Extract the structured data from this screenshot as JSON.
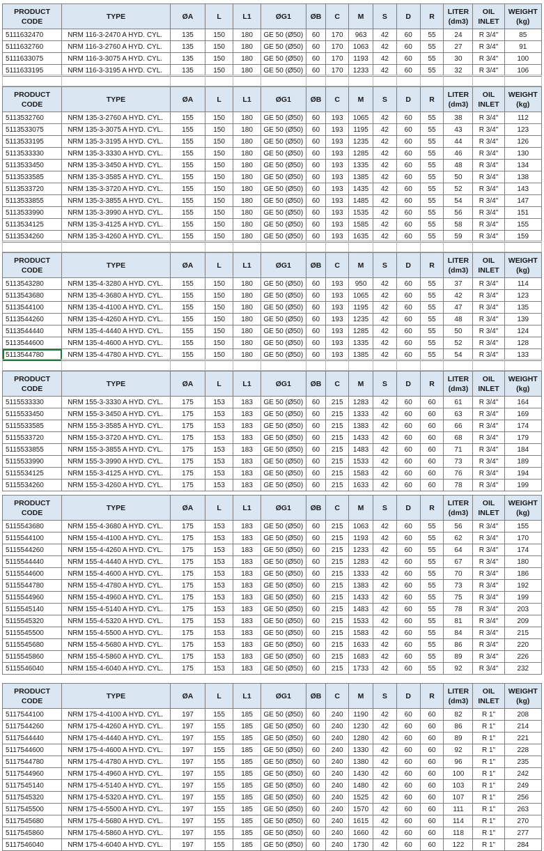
{
  "headers": {
    "code": "PRODUCT CODE",
    "type": "TYPE",
    "a": "ØA",
    "l": "L",
    "l1": "L1",
    "g1": "ØG1",
    "b": "ØB",
    "c": "C",
    "m": "M",
    "s": "S",
    "d": "D",
    "r": "R",
    "liter": "LITER (dm3)",
    "oil": "OIL INLET",
    "weight": "WEIGHT (kg)"
  },
  "blocks": [
    {
      "rows": [
        [
          "5111632470",
          "NRM 116-3-2470 A HYD. CYL.",
          "135",
          "150",
          "180",
          "GE 50 (Ø50)",
          "60",
          "170",
          "963",
          "42",
          "60",
          "55",
          "24",
          "R 3/4\"",
          "85"
        ],
        [
          "5111632760",
          "NRM 116-3-2760 A HYD. CYL.",
          "135",
          "150",
          "180",
          "GE 50 (Ø50)",
          "60",
          "170",
          "1063",
          "42",
          "60",
          "55",
          "27",
          "R 3/4\"",
          "91"
        ],
        [
          "5111633075",
          "NRM 116-3-3075 A HYD. CYL.",
          "135",
          "150",
          "180",
          "GE 50 (Ø50)",
          "60",
          "170",
          "1193",
          "42",
          "60",
          "55",
          "30",
          "R 3/4\"",
          "100"
        ],
        [
          "5111633195",
          "NRM 116-3-3195 A HYD. CYL.",
          "135",
          "150",
          "180",
          "GE 50 (Ø50)",
          "60",
          "170",
          "1233",
          "42",
          "60",
          "55",
          "32",
          "R 3/4\"",
          "106"
        ]
      ]
    },
    {
      "rows": [
        [
          "5113532760",
          "NRM 135-3-2760 A HYD. CYL.",
          "155",
          "150",
          "180",
          "GE 50 (Ø50)",
          "60",
          "193",
          "1065",
          "42",
          "60",
          "55",
          "38",
          "R 3/4\"",
          "112"
        ],
        [
          "5113533075",
          "NRM 135-3-3075 A HYD. CYL.",
          "155",
          "150",
          "180",
          "GE 50 (Ø50)",
          "60",
          "193",
          "1195",
          "42",
          "60",
          "55",
          "43",
          "R 3/4\"",
          "123"
        ],
        [
          "5113533195",
          "NRM 135-3-3195 A HYD. CYL.",
          "155",
          "150",
          "180",
          "GE 50 (Ø50)",
          "60",
          "193",
          "1235",
          "42",
          "60",
          "55",
          "44",
          "R 3/4\"",
          "126"
        ],
        [
          "5113533330",
          "NRM 135-3-3330 A HYD. CYL.",
          "155",
          "150",
          "180",
          "GE 50 (Ø50)",
          "60",
          "193",
          "1285",
          "42",
          "60",
          "55",
          "46",
          "R 3/4\"",
          "130"
        ],
        [
          "5113533450",
          "NRM 135-3-3450 A HYD. CYL.",
          "155",
          "150",
          "180",
          "GE 50 (Ø50)",
          "60",
          "193",
          "1335",
          "42",
          "60",
          "55",
          "48",
          "R 3/4\"",
          "134"
        ],
        [
          "5113533585",
          "NRM 135-3-3585 A HYD. CYL.",
          "155",
          "150",
          "180",
          "GE 50 (Ø50)",
          "60",
          "193",
          "1385",
          "42",
          "60",
          "55",
          "50",
          "R 3/4\"",
          "138"
        ],
        [
          "5113533720",
          "NRM 135-3-3720 A HYD. CYL.",
          "155",
          "150",
          "180",
          "GE 50 (Ø50)",
          "60",
          "193",
          "1435",
          "42",
          "60",
          "55",
          "52",
          "R 3/4\"",
          "143"
        ],
        [
          "5113533855",
          "NRM 135-3-3855 A HYD. CYL.",
          "155",
          "150",
          "180",
          "GE 50 (Ø50)",
          "60",
          "193",
          "1485",
          "42",
          "60",
          "55",
          "54",
          "R 3/4\"",
          "147"
        ],
        [
          "5113533990",
          "NRM 135-3-3990 A HYD. CYL.",
          "155",
          "150",
          "180",
          "GE 50 (Ø50)",
          "60",
          "193",
          "1535",
          "42",
          "60",
          "55",
          "56",
          "R 3/4\"",
          "151"
        ],
        [
          "5113534125",
          "NRM 135-3-4125 A HYD. CYL.",
          "155",
          "150",
          "180",
          "GE 50 (Ø50)",
          "60",
          "193",
          "1585",
          "42",
          "60",
          "55",
          "58",
          "R 3/4\"",
          "155"
        ],
        [
          "5113534260",
          "NRM 135-3-4260 A HYD. CYL.",
          "155",
          "150",
          "180",
          "GE 50 (Ø50)",
          "60",
          "193",
          "1635",
          "42",
          "60",
          "55",
          "59",
          "R 3/4\"",
          "159"
        ]
      ]
    },
    {
      "rows": [
        [
          "5113543280",
          "NRM 135-4-3280 A HYD. CYL.",
          "155",
          "150",
          "180",
          "GE 50 (Ø50)",
          "60",
          "193",
          "950",
          "42",
          "60",
          "55",
          "37",
          "R 3/4\"",
          "114"
        ],
        [
          "5113543680",
          "NRM 135-4-3680 A HYD. CYL.",
          "155",
          "150",
          "180",
          "GE 50 (Ø50)",
          "60",
          "193",
          "1065",
          "42",
          "60",
          "55",
          "42",
          "R 3/4\"",
          "123"
        ],
        [
          "5113544100",
          "NRM 135-4-4100 A HYD. CYL.",
          "155",
          "150",
          "180",
          "GE 50 (Ø50)",
          "60",
          "193",
          "1195",
          "42",
          "60",
          "55",
          "47",
          "R 3/4\"",
          "135"
        ],
        [
          "5113544260",
          "NRM 135-4-4260 A HYD. CYL.",
          "155",
          "150",
          "180",
          "GE 50 (Ø50)",
          "60",
          "193",
          "1235",
          "42",
          "60",
          "55",
          "48",
          "R 3/4\"",
          "139"
        ],
        [
          "5113544440",
          "NRM 135-4-4440 A HYD. CYL.",
          "155",
          "150",
          "180",
          "GE 50 (Ø50)",
          "60",
          "193",
          "1285",
          "42",
          "60",
          "55",
          "50",
          "R 3/4\"",
          "124"
        ],
        [
          "5113544600",
          "NRM 135-4-4600 A HYD. CYL.",
          "155",
          "150",
          "180",
          "GE 50 (Ø50)",
          "60",
          "193",
          "1335",
          "42",
          "60",
          "55",
          "52",
          "R 3/4\"",
          "128"
        ],
        [
          "5113544780",
          "NRM 135-4-4780 A HYD. CYL.",
          "155",
          "150",
          "180",
          "GE 50 (Ø50)",
          "60",
          "193",
          "1385",
          "42",
          "60",
          "55",
          "54",
          "R 3/4\"",
          "133"
        ]
      ]
    },
    {
      "rows": [
        [
          "5115533330",
          "NRM 155-3-3330 A HYD. CYL.",
          "175",
          "153",
          "183",
          "GE 50 (Ø50)",
          "60",
          "215",
          "1283",
          "42",
          "60",
          "60",
          "61",
          "R 3/4\"",
          "164"
        ],
        [
          "5115533450",
          "NRM 155-3-3450 A HYD. CYL.",
          "175",
          "153",
          "183",
          "GE 50 (Ø50)",
          "60",
          "215",
          "1333",
          "42",
          "60",
          "60",
          "63",
          "R 3/4\"",
          "169"
        ],
        [
          "5115533585",
          "NRM 155-3-3585 A HYD. CYL.",
          "175",
          "153",
          "183",
          "GE 50 (Ø50)",
          "60",
          "215",
          "1383",
          "42",
          "60",
          "60",
          "66",
          "R 3/4\"",
          "174"
        ],
        [
          "5115533720",
          "NRM 155-3-3720 A HYD. CYL.",
          "175",
          "153",
          "183",
          "GE 50 (Ø50)",
          "60",
          "215",
          "1433",
          "42",
          "60",
          "60",
          "68",
          "R 3/4\"",
          "179"
        ],
        [
          "5115533855",
          "NRM 155-3-3855 A HYD. CYL.",
          "175",
          "153",
          "183",
          "GE 50 (Ø50)",
          "60",
          "215",
          "1483",
          "42",
          "60",
          "60",
          "71",
          "R 3/4\"",
          "184"
        ],
        [
          "5115533990",
          "NRM 155-3-3990 A HYD. CYL.",
          "175",
          "153",
          "183",
          "GE 50 (Ø50)",
          "60",
          "215",
          "1533",
          "42",
          "60",
          "60",
          "73",
          "R 3/4\"",
          "189"
        ],
        [
          "5115534125",
          "NRM 155-3-4125 A HYD. CYL.",
          "175",
          "153",
          "183",
          "GE 50 (Ø50)",
          "60",
          "215",
          "1583",
          "42",
          "60",
          "60",
          "76",
          "R 3/4\"",
          "194"
        ],
        [
          "5115534260",
          "NRM 155-3-4260 A HYD. CYL.",
          "175",
          "153",
          "183",
          "GE 50 (Ø50)",
          "60",
          "215",
          "1633",
          "42",
          "60",
          "60",
          "78",
          "R 3/4\"",
          "199"
        ]
      ]
    },
    {
      "rows": [
        [
          "5115543680",
          "NRM 155-4-3680 A HYD. CYL.",
          "175",
          "153",
          "183",
          "GE 50 (Ø50)",
          "60",
          "215",
          "1063",
          "42",
          "60",
          "55",
          "56",
          "R 3/4\"",
          "155"
        ],
        [
          "5115544100",
          "NRM 155-4-4100 A HYD. CYL.",
          "175",
          "153",
          "183",
          "GE 50 (Ø50)",
          "60",
          "215",
          "1193",
          "42",
          "60",
          "55",
          "62",
          "R 3/4\"",
          "170"
        ],
        [
          "5115544260",
          "NRM 155-4-4260 A HYD. CYL.",
          "175",
          "153",
          "183",
          "GE 50 (Ø50)",
          "60",
          "215",
          "1233",
          "42",
          "60",
          "55",
          "64",
          "R 3/4\"",
          "174"
        ],
        [
          "5115544440",
          "NRM 155-4-4440 A HYD. CYL.",
          "175",
          "153",
          "183",
          "GE 50 (Ø50)",
          "60",
          "215",
          "1283",
          "42",
          "60",
          "55",
          "67",
          "R 3/4\"",
          "180"
        ],
        [
          "5115544600",
          "NRM 155-4-4600 A HYD. CYL.",
          "175",
          "153",
          "183",
          "GE 50 (Ø50)",
          "60",
          "215",
          "1333",
          "42",
          "60",
          "55",
          "70",
          "R 3/4\"",
          "186"
        ],
        [
          "5115544780",
          "NRM 155-4-4780 A HYD. CYL.",
          "175",
          "153",
          "183",
          "GE 50 (Ø50)",
          "60",
          "215",
          "1383",
          "42",
          "60",
          "55",
          "73",
          "R 3/4\"",
          "192"
        ],
        [
          "5115544960",
          "NRM 155-4-4960 A HYD. CYL.",
          "175",
          "153",
          "183",
          "GE 50 (Ø50)",
          "60",
          "215",
          "1433",
          "42",
          "60",
          "55",
          "75",
          "R 3/4\"",
          "199"
        ],
        [
          "5115545140",
          "NRM 155-4-5140 A HYD. CYL.",
          "175",
          "153",
          "183",
          "GE 50 (Ø50)",
          "60",
          "215",
          "1483",
          "42",
          "60",
          "55",
          "78",
          "R 3/4\"",
          "203"
        ],
        [
          "5115545320",
          "NRM 155-4-5320 A HYD. CYL.",
          "175",
          "153",
          "183",
          "GE 50 (Ø50)",
          "60",
          "215",
          "1533",
          "42",
          "60",
          "55",
          "81",
          "R 3/4\"",
          "209"
        ],
        [
          "5115545500",
          "NRM 155-4-5500 A HYD. CYL.",
          "175",
          "153",
          "183",
          "GE 50 (Ø50)",
          "60",
          "215",
          "1583",
          "42",
          "60",
          "55",
          "84",
          "R 3/4\"",
          "215"
        ],
        [
          "5115545680",
          "NRM 155-4-5680 A HYD. CYL.",
          "175",
          "153",
          "183",
          "GE 50 (Ø50)",
          "60",
          "215",
          "1633",
          "42",
          "60",
          "55",
          "86",
          "R 3/4\"",
          "220"
        ],
        [
          "5115545860",
          "NRM 155-4-5860 A HYD. CYL.",
          "175",
          "153",
          "183",
          "GE 50 (Ø50)",
          "60",
          "215",
          "1683",
          "42",
          "60",
          "55",
          "89",
          "R 3/4\"",
          "226"
        ],
        [
          "5115546040",
          "NRM 155-4-6040 A HYD. CYL.",
          "175",
          "153",
          "183",
          "GE 50 (Ø50)",
          "60",
          "215",
          "1733",
          "42",
          "60",
          "55",
          "92",
          "R 3/4\"",
          "232"
        ]
      ]
    },
    {
      "rows": [
        [
          "5117544100",
          "NRM 175-4-4100 A HYD. CYL.",
          "197",
          "155",
          "185",
          "GE 50 (Ø50)",
          "60",
          "240",
          "1190",
          "42",
          "60",
          "60",
          "82",
          "R 1\"",
          "208"
        ],
        [
          "5117544260",
          "NRM 175-4-4260 A HYD. CYL.",
          "197",
          "155",
          "185",
          "GE 50 (Ø50)",
          "60",
          "240",
          "1230",
          "42",
          "60",
          "60",
          "86",
          "R 1\"",
          "214"
        ],
        [
          "5117544440",
          "NRM 175-4-4440 A HYD. CYL.",
          "197",
          "155",
          "185",
          "GE 50 (Ø50)",
          "60",
          "240",
          "1280",
          "42",
          "60",
          "60",
          "89",
          "R 1\"",
          "221"
        ],
        [
          "5117544600",
          "NRM 175-4-4600 A HYD. CYL.",
          "197",
          "155",
          "185",
          "GE 50 (Ø50)",
          "60",
          "240",
          "1330",
          "42",
          "60",
          "60",
          "92",
          "R 1\"",
          "228"
        ],
        [
          "5117544780",
          "NRM 175-4-4780 A HYD. CYL.",
          "197",
          "155",
          "185",
          "GE 50 (Ø50)",
          "60",
          "240",
          "1380",
          "42",
          "60",
          "60",
          "96",
          "R 1\"",
          "235"
        ],
        [
          "5117544960",
          "NRM 175-4-4960 A HYD. CYL.",
          "197",
          "155",
          "185",
          "GE 50 (Ø50)",
          "60",
          "240",
          "1430",
          "42",
          "60",
          "60",
          "100",
          "R 1\"",
          "242"
        ],
        [
          "5117545140",
          "NRM 175-4-5140 A HYD. CYL.",
          "197",
          "155",
          "185",
          "GE 50 (Ø50)",
          "60",
          "240",
          "1480",
          "42",
          "60",
          "60",
          "103",
          "R 1\"",
          "249"
        ],
        [
          "5117545320",
          "NRM 175-4-5320 A HYD. CYL.",
          "197",
          "155",
          "185",
          "GE 50 (Ø50)",
          "60",
          "240",
          "1525",
          "42",
          "60",
          "60",
          "107",
          "R 1\"",
          "256"
        ],
        [
          "5117545500",
          "NRM 175-4-5500 A HYD. CYL.",
          "197",
          "155",
          "185",
          "GE 50 (Ø50)",
          "60",
          "240",
          "1570",
          "42",
          "60",
          "60",
          "111",
          "R 1\"",
          "263"
        ],
        [
          "5117545680",
          "NRM 175-4-5680 A HYD. CYL.",
          "197",
          "155",
          "185",
          "GE 50 (Ø50)",
          "60",
          "240",
          "1615",
          "42",
          "60",
          "60",
          "114",
          "R 1\"",
          "270"
        ],
        [
          "5117545860",
          "NRM 175-4-5860 A HYD. CYL.",
          "197",
          "155",
          "185",
          "GE 50 (Ø50)",
          "60",
          "240",
          "1660",
          "42",
          "60",
          "60",
          "118",
          "R 1\"",
          "277"
        ],
        [
          "5117546040",
          "NRM 175-4-6040 A HYD. CYL.",
          "197",
          "155",
          "185",
          "GE 50 (Ø50)",
          "60",
          "240",
          "1730",
          "42",
          "60",
          "60",
          "122",
          "R 1\"",
          "284"
        ]
      ]
    }
  ]
}
